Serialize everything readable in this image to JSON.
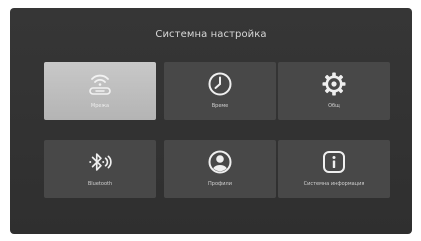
{
  "screen": {
    "title": "Системна настройка"
  },
  "tiles": [
    {
      "label": "Мрежа",
      "icon": "network-icon",
      "selected": true
    },
    {
      "label": "Време",
      "icon": "clock-icon",
      "selected": false
    },
    {
      "label": "Общ",
      "icon": "gear-icon",
      "selected": false
    },
    {
      "label": "Bluetooth",
      "icon": "bluetooth-icon",
      "selected": false
    },
    {
      "label": "Профили",
      "icon": "profile-icon",
      "selected": false
    },
    {
      "label": "Системна информация",
      "icon": "info-icon",
      "selected": false
    }
  ],
  "colors": {
    "background": "#333333",
    "tile": "#484848",
    "tile_selected": "#bdbdbd",
    "text": "#d9d9d9"
  }
}
